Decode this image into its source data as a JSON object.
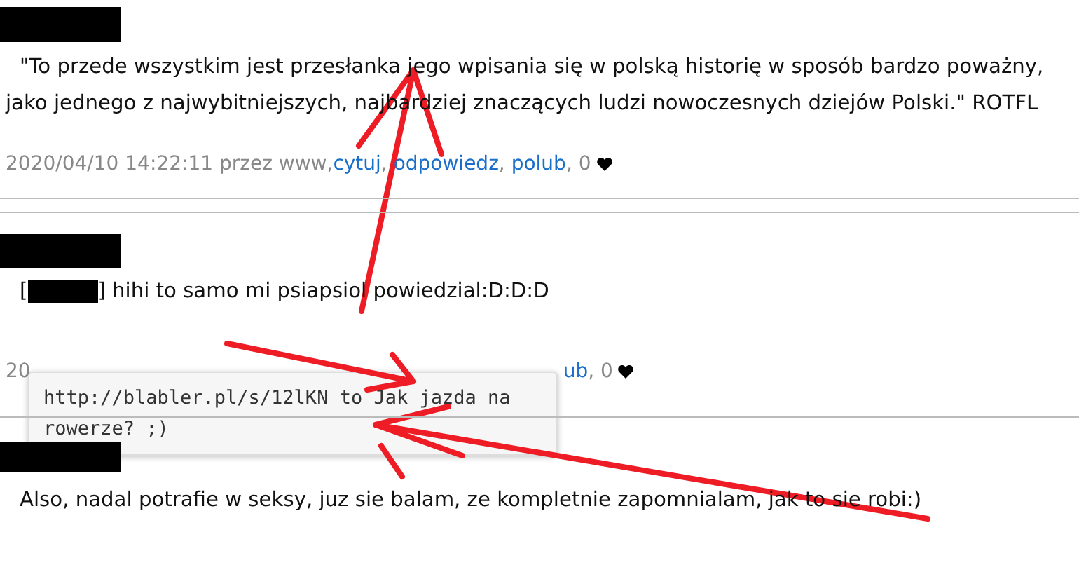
{
  "posts": [
    {
      "body": "\"To przede wszystkim jest przesłanka jego wpisania się w polską historię w sposób bardzo poważny, jako jednego z najwybitniejszych, najbardziej znaczących ludzi nowoczesnych dziejów Polski.\" ROTFL",
      "meta": {
        "date": "2020/04/10 14:22:11 przez www,",
        "links": [
          "cytuj",
          "odpowiedz",
          "polub"
        ],
        "separator": ",",
        "likes": "0"
      }
    },
    {
      "bracket": "[",
      "body": "] hihi to samo mi psiapsiol powiedzial:D:D:D",
      "meta": {
        "date": "20",
        "links": [
          "ub"
        ],
        "separator": ",",
        "likes": "0"
      }
    },
    {
      "body": "Also, nadal potrafie w seksy, juz sie balam, ze kompletnie zapomnialam, jak to sie robi:)"
    }
  ],
  "tooltip": {
    "text": "http://blabler.pl/s/12lKN to Jak jazda na rowerze? ;)"
  }
}
